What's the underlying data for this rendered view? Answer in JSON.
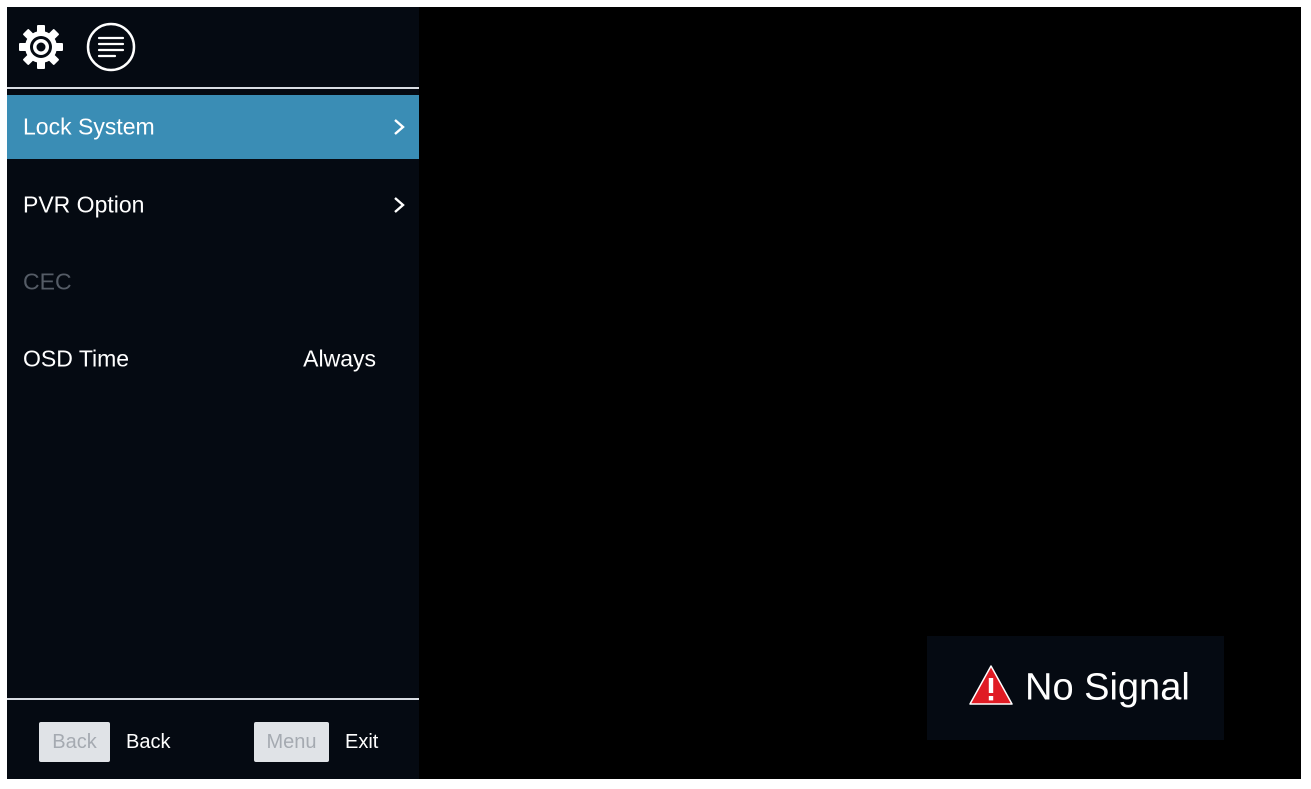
{
  "header": {
    "settings_icon": "gear-icon",
    "menu_icon": "list-icon"
  },
  "menu": {
    "items": [
      {
        "label": "Lock System",
        "value": "",
        "arrow": ">",
        "state": "selected"
      },
      {
        "label": "PVR Option",
        "value": "",
        "arrow": ">",
        "state": "normal"
      },
      {
        "label": "CEC",
        "value": "",
        "arrow": "",
        "state": "disabled"
      },
      {
        "label": "OSD Time",
        "value": "Always",
        "arrow": "",
        "state": "normal"
      }
    ]
  },
  "footer": {
    "back_key": "Back",
    "back_label": "Back",
    "menu_key": "Menu",
    "exit_label": "Exit"
  },
  "status": {
    "message": "No Signal",
    "icon": "warning-icon"
  },
  "colors": {
    "selected_bg": "#3a8db5",
    "panel_bg": "#050a12",
    "warning_red": "#e01b24"
  }
}
